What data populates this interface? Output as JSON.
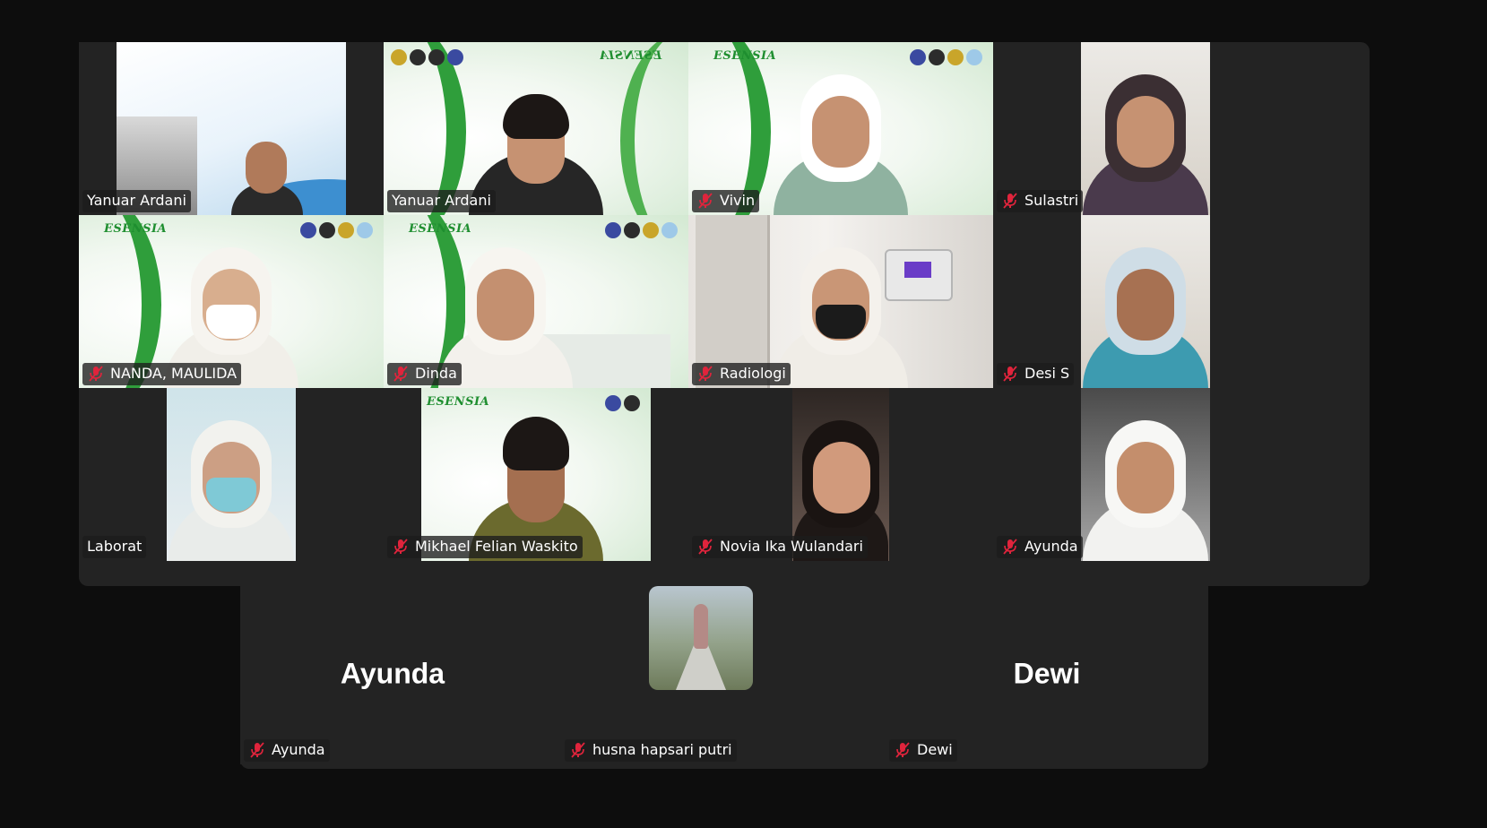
{
  "meeting": {
    "participants": [
      {
        "name": "Yanuar Ardani",
        "muted": false,
        "active_speaker": false,
        "has_video": true
      },
      {
        "name": "Yanuar Ardani",
        "muted": false,
        "active_speaker": true,
        "has_video": true
      },
      {
        "name": "Vivin",
        "muted": true,
        "active_speaker": false,
        "has_video": true
      },
      {
        "name": "Sulastri",
        "muted": true,
        "active_speaker": false,
        "has_video": true
      },
      {
        "name": "NANDA, MAULIDA",
        "muted": true,
        "active_speaker": false,
        "has_video": true
      },
      {
        "name": "Dinda",
        "muted": true,
        "active_speaker": false,
        "has_video": true
      },
      {
        "name": "Radiologi",
        "muted": true,
        "active_speaker": false,
        "has_video": true
      },
      {
        "name": "Desi S",
        "muted": true,
        "active_speaker": false,
        "has_video": true
      },
      {
        "name": "Laborat",
        "muted": false,
        "active_speaker": false,
        "has_video": true
      },
      {
        "name": "Mikhael Felian Waskito",
        "muted": true,
        "active_speaker": false,
        "has_video": true
      },
      {
        "name": "Novia Ika Wulandari",
        "muted": true,
        "active_speaker": false,
        "has_video": true
      },
      {
        "name": "Ayunda",
        "muted": true,
        "active_speaker": false,
        "has_video": true
      }
    ],
    "no_video_participants": [
      {
        "name": "Ayunda",
        "display_text": "Ayunda",
        "muted": true
      },
      {
        "name": "husna hapsari putri",
        "display_text": "",
        "muted": true,
        "has_profile_photo": true
      },
      {
        "name": "Dewi",
        "display_text": "Dewi",
        "muted": true
      }
    ],
    "slide_logo_text": "ESENSIA",
    "colors": {
      "background": "#0d0d0d",
      "panel": "#232323",
      "active_border": "#19d36a",
      "mic_off": "#e0243c",
      "label_text": "#ffffff"
    }
  }
}
